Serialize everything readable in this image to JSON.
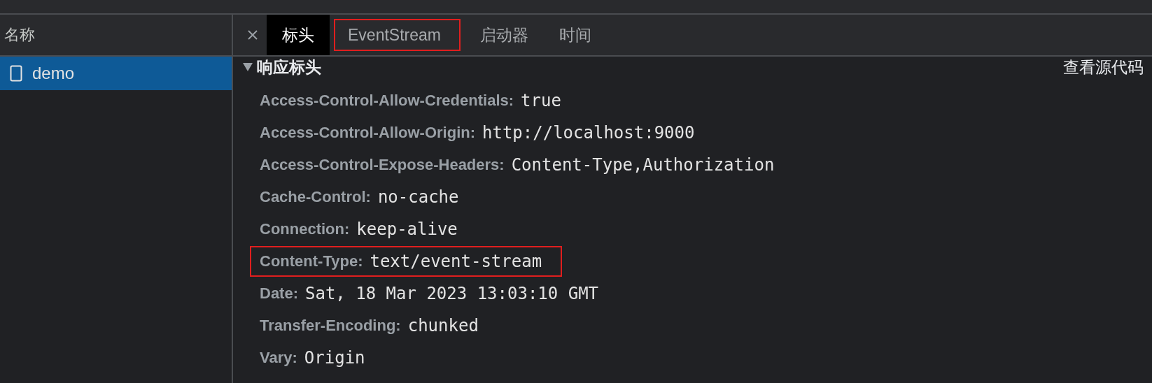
{
  "sidebar": {
    "heading": "名称",
    "items": [
      {
        "label": "demo",
        "selected": true
      }
    ]
  },
  "tabs": [
    {
      "label": "标头",
      "selected": true,
      "highlighted": false
    },
    {
      "label": "EventStream",
      "selected": false,
      "highlighted": true
    },
    {
      "label": "启动器",
      "selected": false,
      "highlighted": false
    },
    {
      "label": "时间",
      "selected": false,
      "highlighted": false
    }
  ],
  "section": {
    "title": "响应标头",
    "expanded": true,
    "view_source": "查看源代码"
  },
  "headers": [
    {
      "name": "Access-Control-Allow-Credentials:",
      "value": "true",
      "highlighted": false
    },
    {
      "name": "Access-Control-Allow-Origin:",
      "value": "http://localhost:9000",
      "highlighted": false
    },
    {
      "name": "Access-Control-Expose-Headers:",
      "value": "Content-Type,Authorization",
      "highlighted": false
    },
    {
      "name": "Cache-Control:",
      "value": "no-cache",
      "highlighted": false
    },
    {
      "name": "Connection:",
      "value": "keep-alive",
      "highlighted": false
    },
    {
      "name": "Content-Type:",
      "value": "text/event-stream",
      "highlighted": true
    },
    {
      "name": "Date:",
      "value": "Sat, 18 Mar 2023 13:03:10 GMT",
      "highlighted": false
    },
    {
      "name": "Transfer-Encoding:",
      "value": "chunked",
      "highlighted": false
    },
    {
      "name": "Vary:",
      "value": "Origin",
      "highlighted": false
    }
  ]
}
